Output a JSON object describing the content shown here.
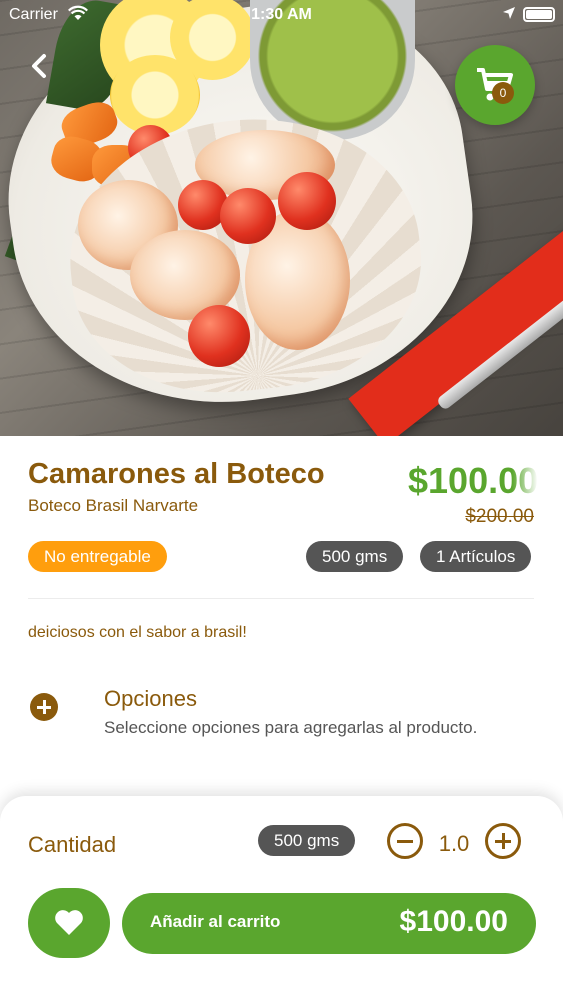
{
  "status_bar": {
    "carrier": "Carrier",
    "time": "1:30 AM"
  },
  "header": {
    "cart_count": "0"
  },
  "product": {
    "title": "Camarones al Boteco",
    "restaurant": "Boteco Brasil Narvarte",
    "price": "$100.00",
    "old_price": "$200.00",
    "availability_badge": "No entregable",
    "weight": "500 gms",
    "articles": "1 Artículos",
    "description": "deiciosos con el sabor a brasil!"
  },
  "options": {
    "title": "Opciones",
    "subtitle": "Seleccione opciones para agregarlas al producto."
  },
  "bottom_bar": {
    "quantity_label": "Cantidad",
    "weight": "500 gms",
    "quantity_value": "1.0",
    "add_label": "Añadir al carrito",
    "add_price": "$100.00"
  },
  "colors": {
    "brand_green": "#5aa62e",
    "brown": "#8a5a0c",
    "orange": "#ff9e0d",
    "chip_gray": "#555555"
  },
  "icons": [
    "back-arrow-icon",
    "cart-icon",
    "plus-circle-icon",
    "minus-circle-icon",
    "heart-icon",
    "wifi-icon",
    "location-arrow-icon",
    "battery-icon"
  ]
}
